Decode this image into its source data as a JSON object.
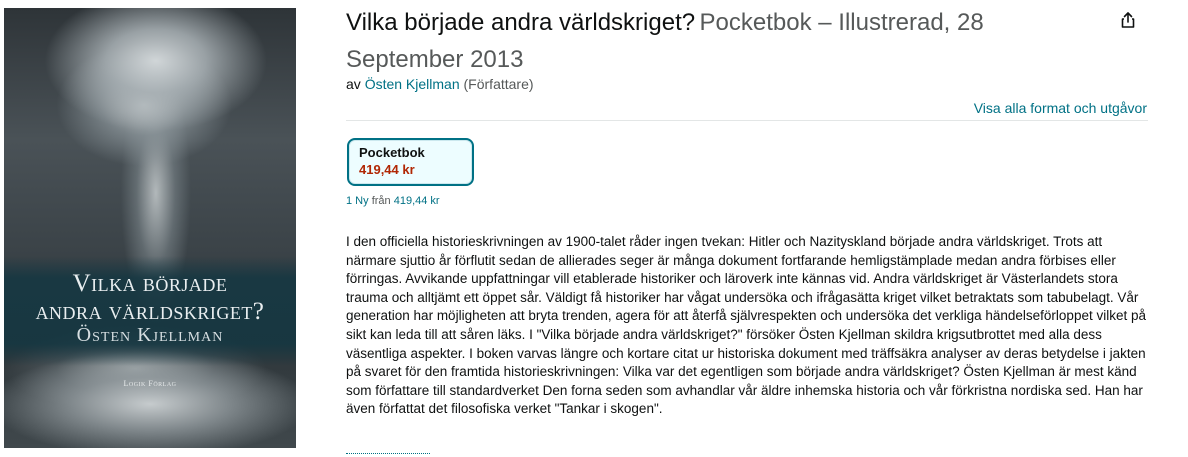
{
  "cover": {
    "title_line1": "Vilka började",
    "title_line2": "andra världskriget?",
    "author": "Östen Kjellman",
    "publisher": "Logik Förlag"
  },
  "product": {
    "title": "Vilka började andra världskriget?",
    "subtitle": "Pocketbok – Illustrerad, 28 September 2013",
    "by_prefix": "av",
    "author": "Östen Kjellman",
    "author_role": "(Författare)",
    "all_formats_link": "Visa alla format och utgåvor"
  },
  "format": {
    "name": "Pocketbok",
    "price": "419,44 kr"
  },
  "offers": {
    "count_text": "1 Ny",
    "from_text": "från",
    "price": "419,44 kr"
  },
  "description": "I den officiella historieskrivningen av 1900-talet råder ingen tvekan: Hitler och Nazityskland började andra världskriget. Trots att närmare sjuttio år förflutit sedan de allierades seger är många dokument fortfarande hemligstämplade medan andra förbises eller förringas. Avvikande uppfattningar vill etablerade historiker och läroverk inte kännas vid. Andra världskriget är Västerlandets stora trauma och alltjämt ett öppet sår. Väldigt få historiker har vågat undersöka och ifrågasätta kriget vilket betraktats som tabubelagt. Vår generation har möjligheten att bryta trenden, agera för att återfå självrespekten och undersöka det verkliga händelseförloppet vilket på sikt kan leda till att såren läks. I \"Vilka började andra världskriget?\" försöker Östen Kjellman skildra krigsutbrottet med alla dess väsentliga aspekter. I boken varvas längre och kortare citat ur historiska dokument med träffsäkra analyser av deras betydelse i jakten på svaret för den framtida historieskrivningen: Vilka var det egentligen som började andra världskriget? Östen Kjellman är mest känd som författare till standardverket Den forna seden som avhandlar vår äldre inhemska historia och vår förkristna nordiska sed. Han har även författat det filosofiska verket \"Tankar i skogen\".",
  "icons": {
    "share": "share-icon"
  },
  "colors": {
    "link": "#007185",
    "price": "#b12704",
    "selected_border": "#007185",
    "selected_bg": "#edfdff"
  }
}
